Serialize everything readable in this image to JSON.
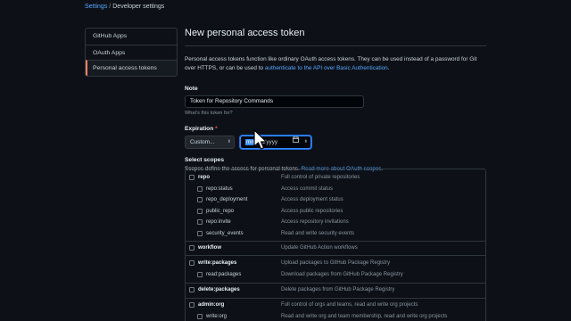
{
  "breadcrumb": {
    "settings": "Settings",
    "separator": "/",
    "current": "Developer settings"
  },
  "sidebar": {
    "items": [
      {
        "label": "GitHub Apps"
      },
      {
        "label": "OAuth Apps"
      },
      {
        "label": "Personal access tokens",
        "active": true
      }
    ]
  },
  "page": {
    "title": "New personal access token",
    "intro_text": "Personal access tokens function like ordinary OAuth access tokens. They can be used instead of a password for Git over HTTPS, or can be used to",
    "intro_link": "authenticate to the API over Basic Authentication",
    "intro_end": "."
  },
  "note": {
    "label": "Note",
    "value": "Token for Repository Commands",
    "hint": "What's this token for?"
  },
  "expiration": {
    "label": "Expiration",
    "required_mark": "*",
    "select_value": "Custom...",
    "date_highlight": "mm",
    "date_rest": "/dd/yyyy"
  },
  "scopes": {
    "label": "Select scopes",
    "description": "Scopes define the access for personal tokens.",
    "link": "Read more about OAuth scopes.",
    "items": [
      {
        "name": "repo",
        "desc": "Full control of private repositories",
        "parent": true
      },
      {
        "name": "repo:status",
        "desc": "Access commit status",
        "parent": false
      },
      {
        "name": "repo_deployment",
        "desc": "Access deployment status",
        "parent": false
      },
      {
        "name": "public_repo",
        "desc": "Access public repositories",
        "parent": false
      },
      {
        "name": "repo:invite",
        "desc": "Access repository invitations",
        "parent": false
      },
      {
        "name": "security_events",
        "desc": "Read and write security events",
        "parent": false
      },
      {
        "name": "workflow",
        "desc": "Update GitHub Action workflows",
        "parent": true
      },
      {
        "name": "write:packages",
        "desc": "Upload packages to GitHub Package Registry",
        "parent": true
      },
      {
        "name": "read:packages",
        "desc": "Download packages from GitHub Package Registry",
        "parent": false
      },
      {
        "name": "delete:packages",
        "desc": "Delete packages from GitHub Package Registry",
        "parent": true
      },
      {
        "name": "admin:org",
        "desc": "Full control of orgs and teams, read and write org projects",
        "parent": true
      },
      {
        "name": "write:org",
        "desc": "Read and write org and team membership, read and write org projects",
        "parent": false
      }
    ]
  },
  "colors": {
    "background": "#0d1117",
    "link": "#58a6ff",
    "active_accent": "#f78166",
    "focus": "#388bfd"
  }
}
